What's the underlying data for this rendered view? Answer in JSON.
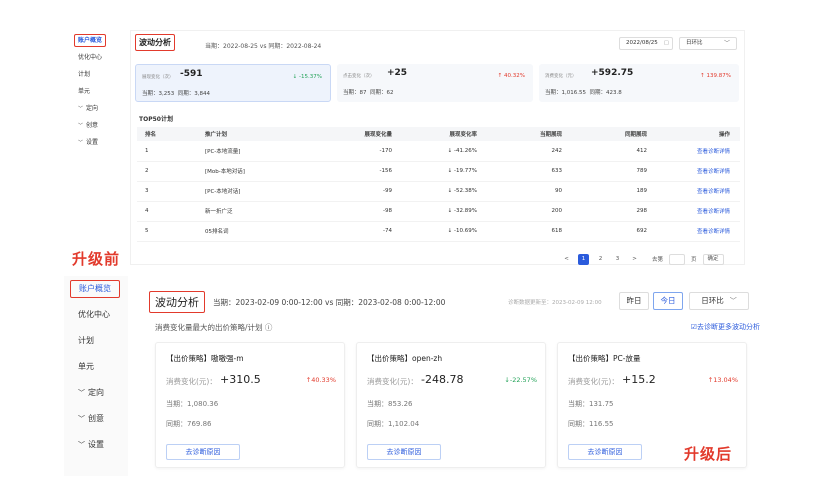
{
  "before": {
    "label": "升级前",
    "sidebar": [
      {
        "label": "账户概览",
        "caret": ""
      },
      {
        "label": "优化中心",
        "caret": ""
      },
      {
        "label": "计划",
        "caret": ""
      },
      {
        "label": "单元",
        "caret": ""
      },
      {
        "label": "定向",
        "caret": "﹀"
      },
      {
        "label": "创意",
        "caret": "﹀"
      },
      {
        "label": "设置",
        "caret": "﹀"
      }
    ],
    "title": "波动分析",
    "period": "当期：2022-08-25 vs 同期：2022-08-24",
    "date": "2022/08/25",
    "compare": "日环比",
    "cards": [
      {
        "label": "展现变化（次）",
        "value": "-591",
        "change": "↓ -15.37%",
        "current": "当期：3,253",
        "previous": "同期：3,844"
      },
      {
        "label": "点击变化（次）",
        "value": "+25",
        "change": "↑ 40.32%",
        "current": "当期：87",
        "previous": "同期：62"
      },
      {
        "label": "消费变化（元）",
        "value": "+592.75",
        "change": "↑ 139.87%",
        "current": "当期：1,016.55",
        "previous": "同期：423.8"
      }
    ],
    "top50": "TOP50计划",
    "table": {
      "headers": [
        "排名",
        "推广计划",
        "展现变化量",
        "展现变化率",
        "当期展现",
        "同期展现",
        "操作"
      ],
      "rows": [
        [
          "1",
          "[PC-本地流量]",
          "-170",
          "↓ -41.26%",
          "242",
          "412",
          "查看诊断详情"
        ],
        [
          "2",
          "[Mob-本地对话]",
          "-156",
          "↓ -19.77%",
          "633",
          "789",
          "查看诊断详情"
        ],
        [
          "3",
          "[PC-本地对话]",
          "-99",
          "↓ -52.38%",
          "90",
          "189",
          "查看诊断详情"
        ],
        [
          "4",
          "新一折广泛",
          "-98",
          "↓ -32.89%",
          "200",
          "298",
          "查看诊断详情"
        ],
        [
          "5",
          "05排名词",
          "-74",
          "↓ -10.69%",
          "618",
          "692",
          "查看诊断详情"
        ]
      ]
    },
    "pager": {
      "prev": "<",
      "pages": [
        "1",
        "2",
        "3"
      ],
      "next": ">",
      "goto": "去第",
      "page_unit": "页",
      "confirm": "确定"
    }
  },
  "after": {
    "label": "升级后",
    "sidebar": [
      {
        "label": "账户概览",
        "caret": ""
      },
      {
        "label": "优化中心",
        "caret": ""
      },
      {
        "label": "计划",
        "caret": ""
      },
      {
        "label": "单元",
        "caret": ""
      },
      {
        "label": "定向",
        "caret": "﹀"
      },
      {
        "label": "创意",
        "caret": "﹀"
      },
      {
        "label": "设置",
        "caret": "﹀"
      }
    ],
    "title": "波动分析",
    "period": "当期：2023-02-09 0:00-12:00 vs 同期：2023-02-08 0:00-12:00",
    "update": "诊断数据更新至：2023-02-09 12:00",
    "yesterday": "昨日",
    "today": "今日",
    "compare": "日环比",
    "subtitle": "消费变化量最大的出价策略/计划 ⓘ",
    "more": "☑去诊断更多波动分析",
    "cards": [
      {
        "title": "【出价策略】嗷嗷强-m",
        "label": "消费变化(元)：",
        "value": "+310.5",
        "change": "↑40.33%",
        "current": "当期：1,080.36",
        "previous": "同期：769.86",
        "button": "去诊断原因"
      },
      {
        "title": "【出价策略】open-zh",
        "label": "消费变化(元)：",
        "value": "-248.78",
        "change": "↓-22.57%",
        "current": "当期：853.26",
        "previous": "同期：1,102.04",
        "button": "去诊断原因"
      },
      {
        "title": "【出价策略】PC-放量",
        "label": "消费变化(元)：",
        "value": "+15.2",
        "change": "↑13.04%",
        "current": "当期：131.75",
        "previous": "同期：116.55",
        "button": "去诊断原因"
      }
    ]
  }
}
